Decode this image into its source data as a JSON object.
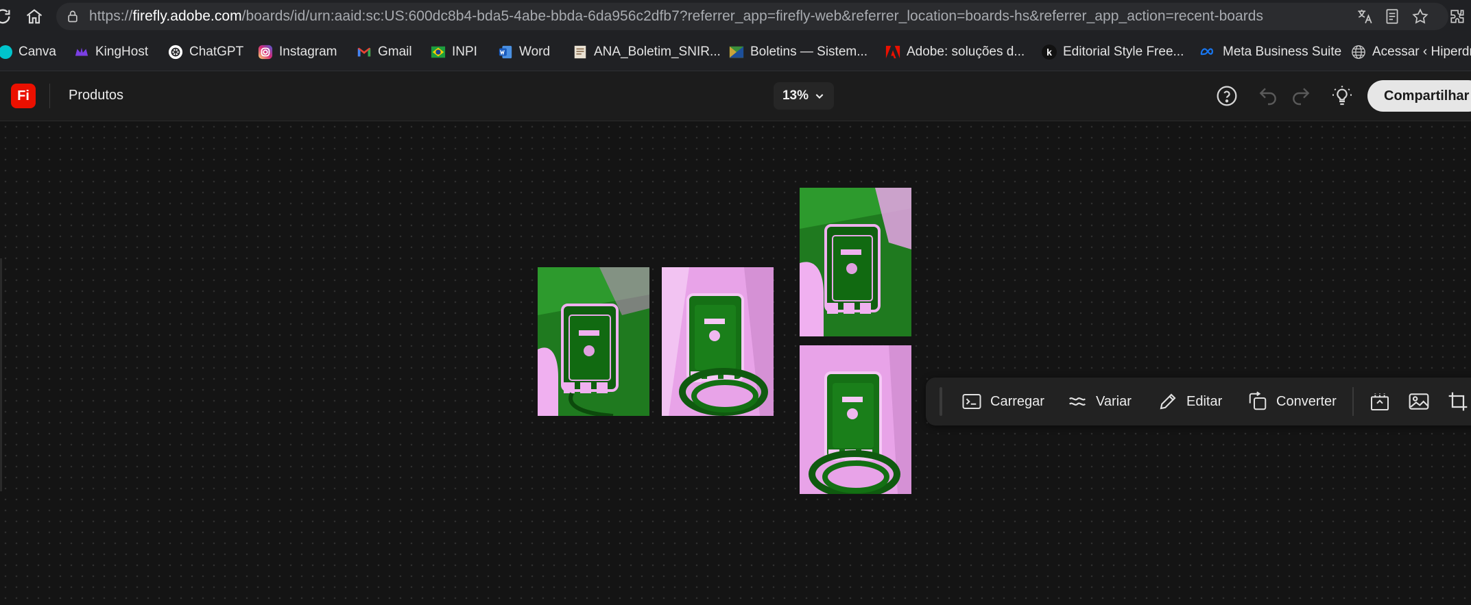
{
  "browser": {
    "url_host": "firefly.adobe.com",
    "url_prefix": "https://",
    "url_path": "/boards/id/urn:aaid:sc:US:600dc8b4-bda5-4abe-bbda-6da956c2dfb7?referrer_app=firefly-web&referrer_location=boards-hs&referrer_app_action=recent-boards",
    "icons": [
      "reload-icon",
      "home-icon",
      "site-info-icon",
      "translate-icon",
      "reading-mode-icon",
      "bookmark-star-icon",
      "extensions-icon"
    ]
  },
  "bookmarks": [
    {
      "label": "Canva",
      "icon": "canva-icon",
      "color": "#00c4cc"
    },
    {
      "label": "KingHost",
      "icon": "kinghost-icon",
      "color": "#7b3fe4"
    },
    {
      "label": "ChatGPT",
      "icon": "chatgpt-icon",
      "color": "#ffffff"
    },
    {
      "label": "Instagram",
      "icon": "instagram-icon",
      "color": "#e1306c"
    },
    {
      "label": "Gmail",
      "icon": "gmail-icon",
      "color": "#ea4335"
    },
    {
      "label": "INPI",
      "icon": "inpi-icon",
      "color": "#1e9e3e"
    },
    {
      "label": "Word",
      "icon": "word-icon",
      "color": "#2b7cd3"
    },
    {
      "label": "ANA_Boletim_SNIR...",
      "icon": "document-icon",
      "color": "#d9d0c0"
    },
    {
      "label": "Boletins — Sistem...",
      "icon": "flag-icon",
      "color": "#3a8f3a"
    },
    {
      "label": "Adobe: soluções d...",
      "icon": "adobe-icon",
      "color": "#eb1000"
    },
    {
      "label": "Editorial Style Free...",
      "icon": "k-icon",
      "color": "#111111"
    },
    {
      "label": "Meta Business Suite",
      "icon": "meta-icon",
      "color": "#1877f2"
    },
    {
      "label": "Acessar ‹ Hiperdro",
      "icon": "globe-icon",
      "color": "#c8c8c8"
    }
  ],
  "app": {
    "logo_text": "Fi",
    "board_name": "Produtos",
    "zoom": "13%",
    "share_label": "Compartilhar",
    "accent": "#eb1000"
  },
  "canvas": {
    "images": [
      {
        "name": "canvas-image-1",
        "palette": "green-dominant"
      },
      {
        "name": "canvas-image-2",
        "palette": "pink-dominant"
      },
      {
        "name": "canvas-image-3",
        "palette": "green-dominant"
      },
      {
        "name": "canvas-image-4",
        "palette": "pink-dominant"
      }
    ]
  },
  "toolbar": {
    "buttons": [
      {
        "label": "Carregar",
        "icon": "prompt-icon"
      },
      {
        "label": "Variar",
        "icon": "variations-icon"
      },
      {
        "label": "Editar",
        "icon": "pencil-icon"
      },
      {
        "label": "Converter",
        "icon": "convert-icon"
      }
    ],
    "extra_icons": [
      "generate-expand-icon",
      "image-icon",
      "crop-icon"
    ]
  }
}
